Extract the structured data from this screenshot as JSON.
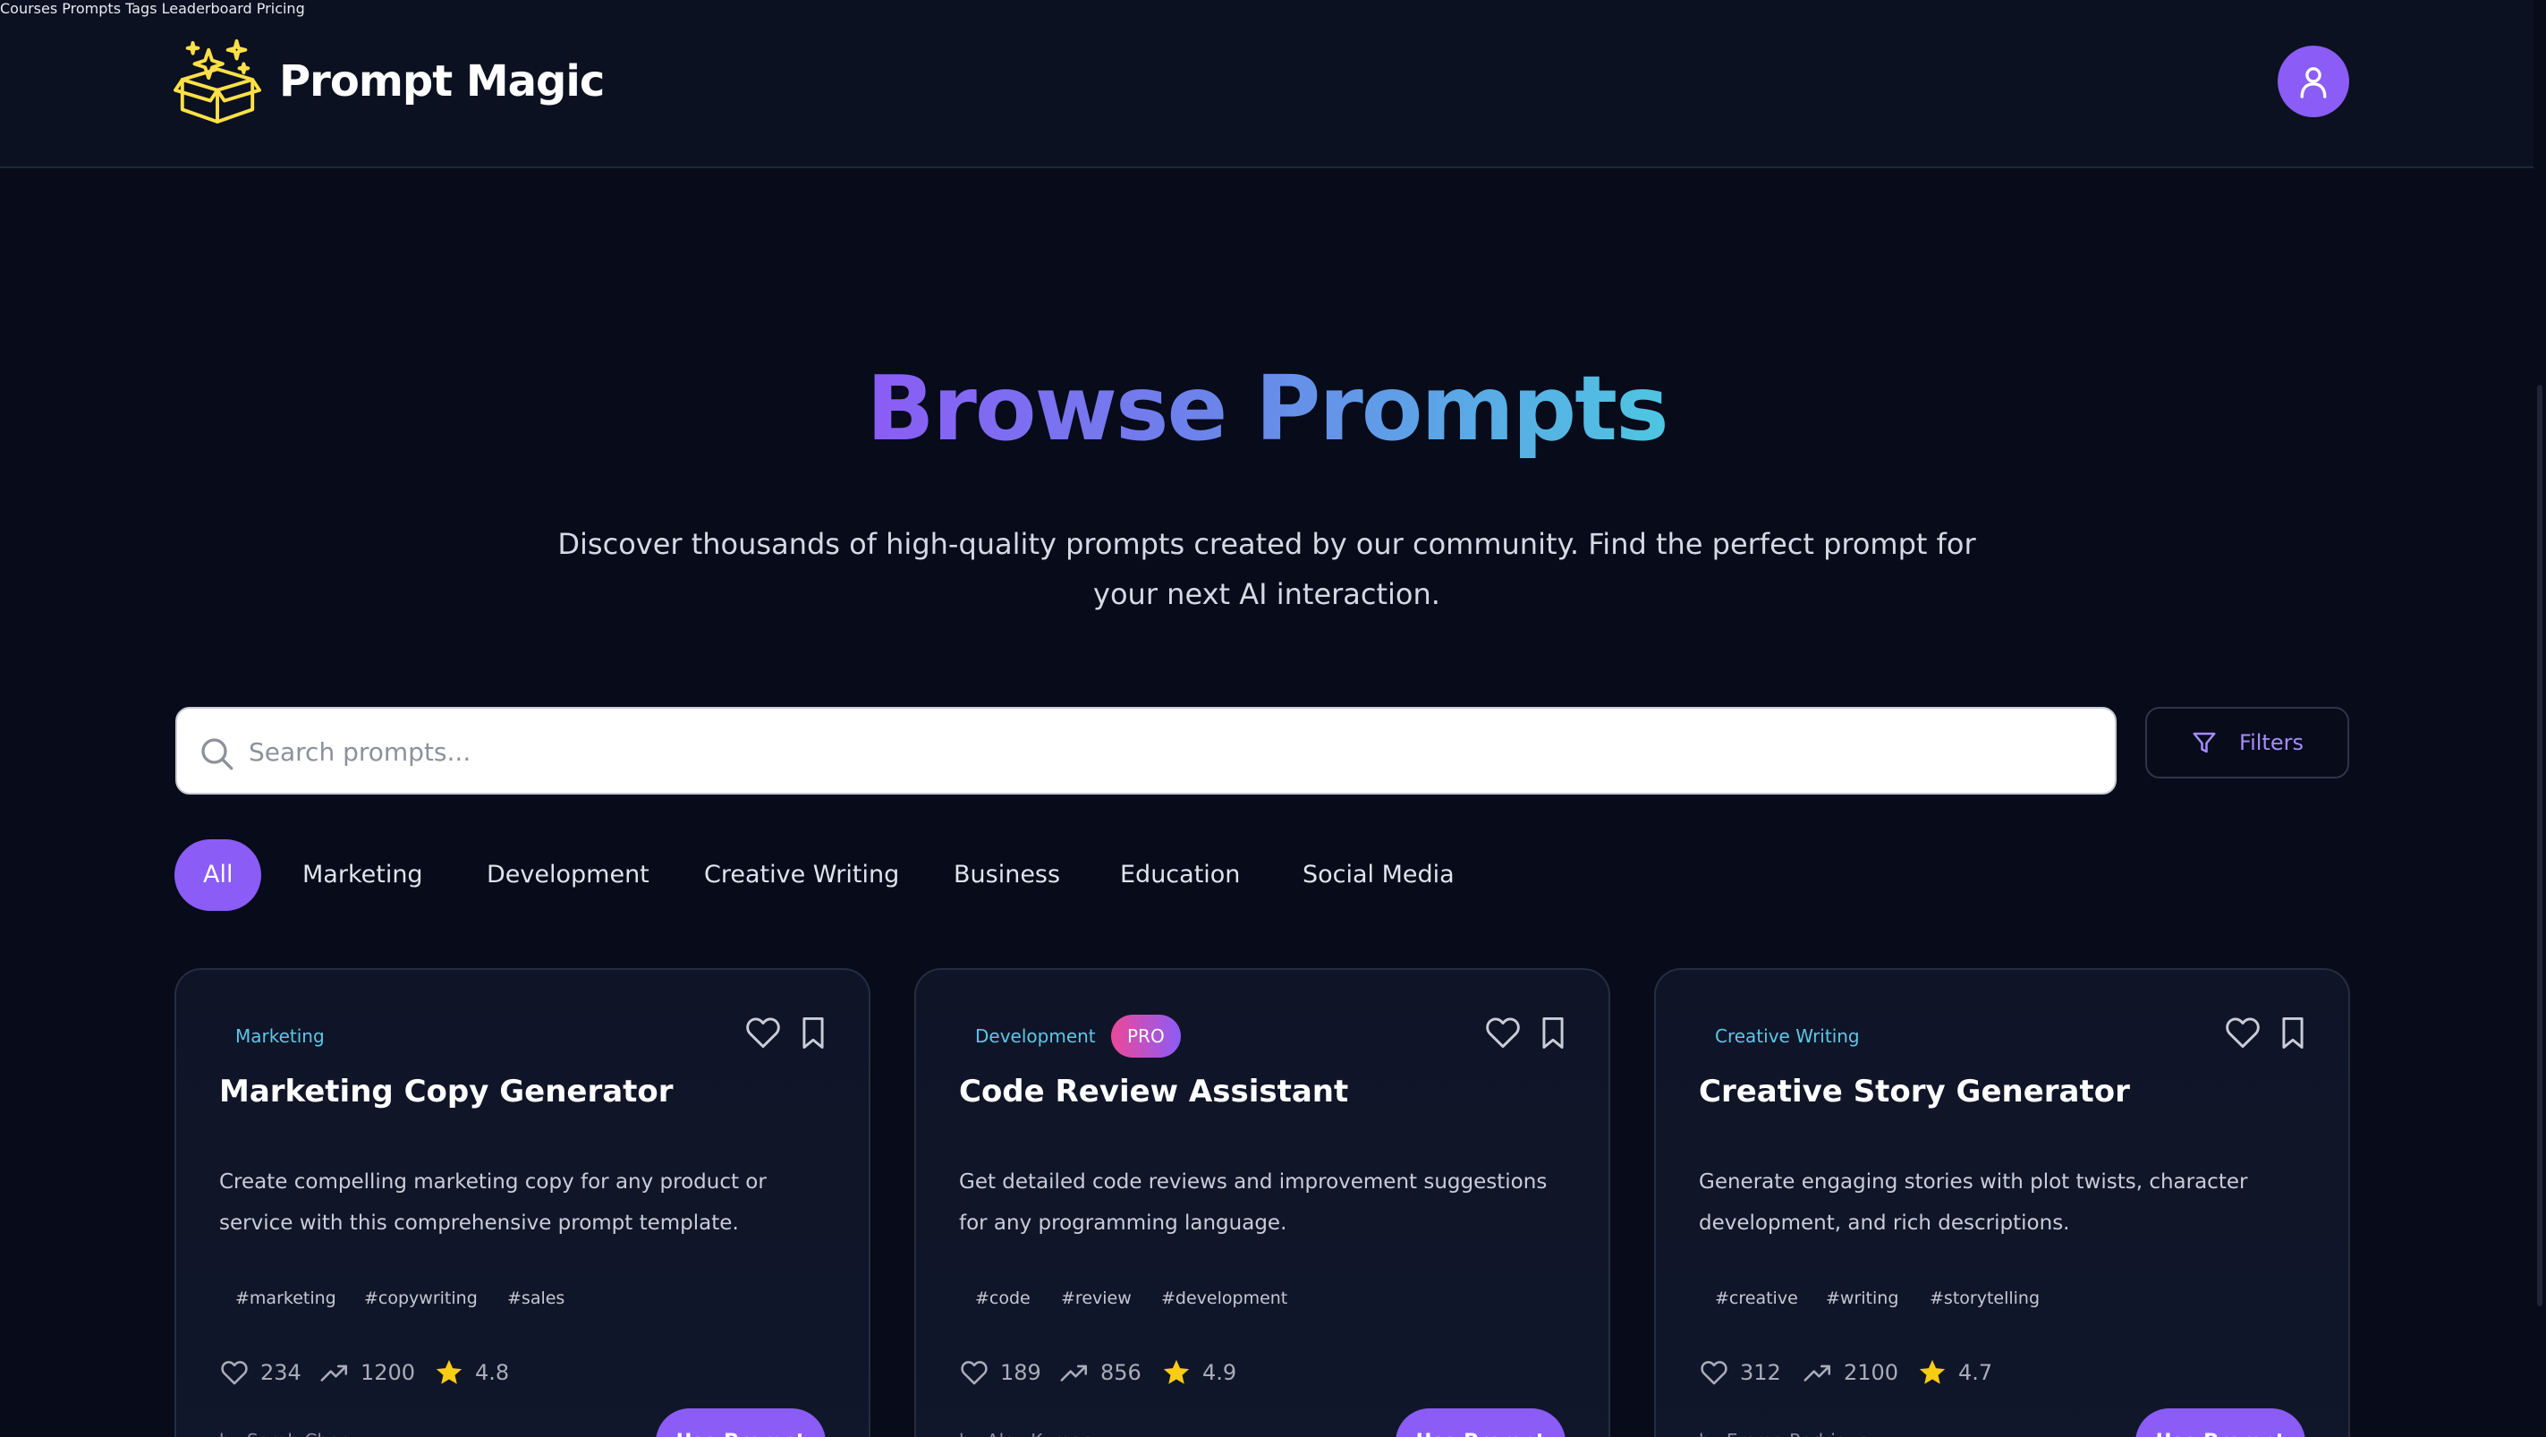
{
  "brand": {
    "name": "Prompt Magic"
  },
  "nav": {
    "items": [
      {
        "label": "Courses"
      },
      {
        "label": "Prompts"
      },
      {
        "label": "Tags"
      },
      {
        "label": "Leaderboard"
      },
      {
        "label": "Pricing"
      }
    ]
  },
  "hero": {
    "title": "Browse Prompts",
    "subtitle": "Discover thousands of high-quality prompts created by our community. Find the perfect prompt for your next AI interaction."
  },
  "search": {
    "placeholder": "Search prompts...",
    "value": ""
  },
  "filters": {
    "label": "Filters"
  },
  "categories": {
    "active": "All",
    "items": [
      "All",
      "Marketing",
      "Development",
      "Creative Writing",
      "Business",
      "Education",
      "Social Media"
    ]
  },
  "cards": [
    {
      "category": "Marketing",
      "pro": false,
      "title": "Marketing Copy Generator",
      "description": "Create compelling marketing copy for any product or service with this comprehensive prompt template.",
      "tags": [
        "#marketing",
        "#copywriting",
        "#sales"
      ],
      "likes": "234",
      "uses": "1200",
      "rating": "4.8",
      "author": "by Sarah Chen",
      "button": "Use Prompt"
    },
    {
      "category": "Development",
      "pro": true,
      "pro_label": "PRO",
      "title": "Code Review Assistant",
      "description": "Get detailed code reviews and improvement suggestions for any programming language.",
      "tags": [
        "#code",
        "#review",
        "#development"
      ],
      "likes": "189",
      "uses": "856",
      "rating": "4.9",
      "author": "by Alex Kumar",
      "button": "Use Prompt"
    },
    {
      "category": "Creative Writing",
      "pro": false,
      "title": "Creative Story Generator",
      "description": "Generate engaging stories with plot twists, character development, and rich descriptions.",
      "tags": [
        "#creative",
        "#writing",
        "#storytelling"
      ],
      "likes": "312",
      "uses": "2100",
      "rating": "4.7",
      "author": "by Emma Rodriguez",
      "button": "Use Prompt"
    }
  ],
  "colors": {
    "background": "#070b1a",
    "accent": "#8b5cf6",
    "category_text": "#5cc7e6",
    "star": "#facc15",
    "logo": "#fde047"
  },
  "icons": {
    "logo": "magic-box-icon",
    "avatar": "user-icon",
    "search": "search-icon",
    "filters": "filter-icon",
    "like": "heart-icon",
    "save": "bookmark-icon",
    "likes_stat": "heart-icon",
    "uses_stat": "trending-up-icon",
    "rating_stat": "star-icon"
  }
}
